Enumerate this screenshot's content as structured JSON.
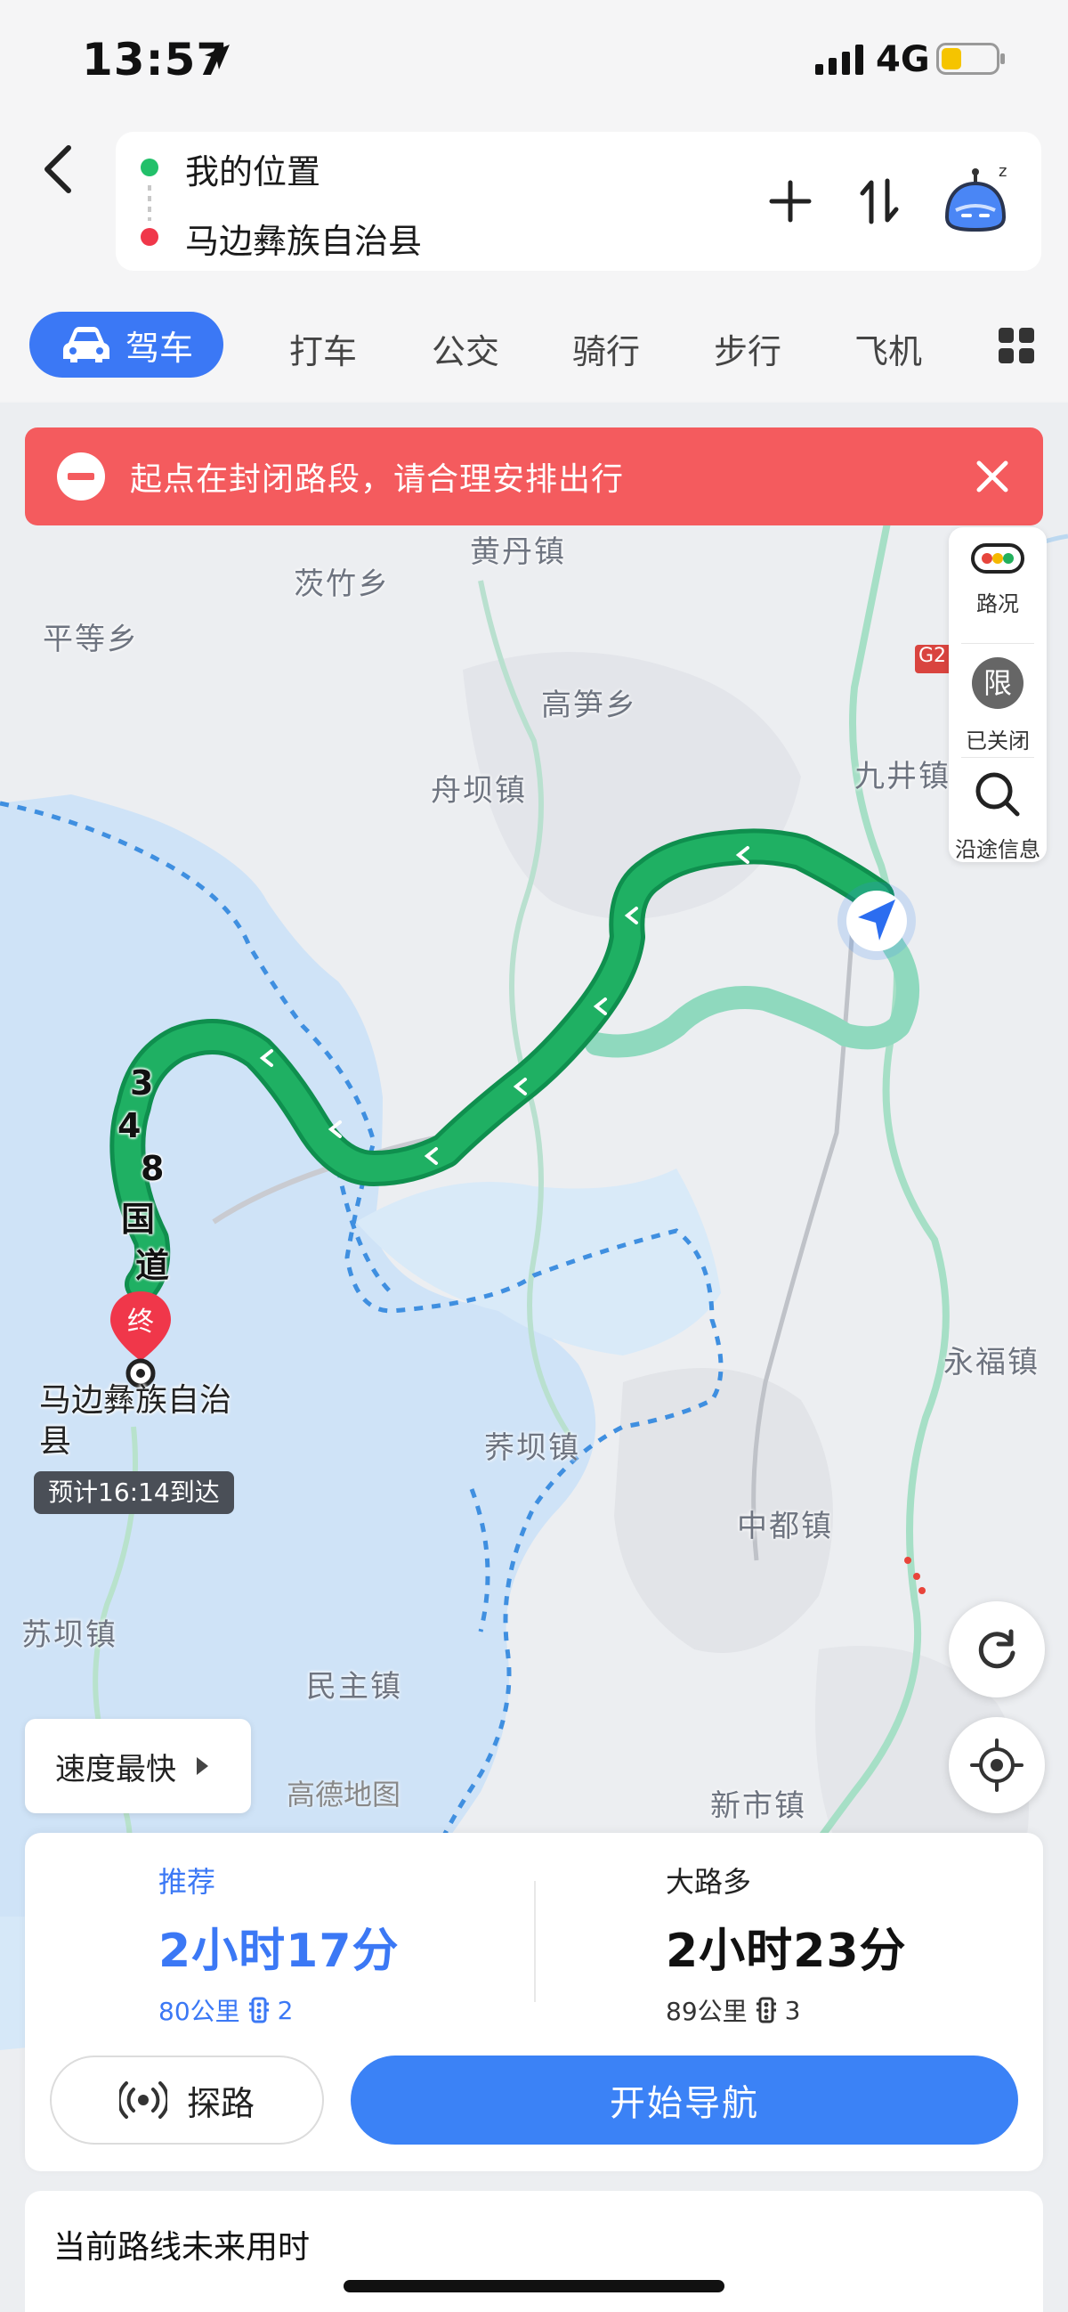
{
  "status": {
    "time": "13:57",
    "network": "4G",
    "battery_color": "#f5c400"
  },
  "route": {
    "start": "我的位置",
    "end": "马边彝族自治县"
  },
  "tabs": {
    "active": "驾车",
    "items": [
      "打车",
      "公交",
      "骑行",
      "步行",
      "飞机"
    ]
  },
  "alert": {
    "text": "起点在封闭路段，请合理安排出行"
  },
  "side_panel": {
    "traffic": "路况",
    "restriction_glyph": "限",
    "restriction": "已关闭",
    "along_route": "沿途信息"
  },
  "map": {
    "labels": {
      "huangdan": "黄丹镇",
      "cizhu": "茨竹乡",
      "pingdeng": "平等乡",
      "gaosun": "高笋乡",
      "zhouba": "舟坝镇",
      "jiujing": "九井镇",
      "yongfu": "永福镇",
      "jiba": "荞坝镇",
      "zhongdu": "中都镇",
      "suba": "苏坝镇",
      "minzhu": "民主镇",
      "xinshi": "新市镇",
      "highway": "G2"
    },
    "road_name_chars": [
      "3",
      "4",
      "8",
      "国",
      "道"
    ],
    "end_marker_glyph": "终",
    "end_name": "马边彝族自治县",
    "eta": "预计16:14到达",
    "watermark": "高德地图",
    "speed_option": "速度最快",
    "colors": {
      "route_main": "#1fb063",
      "route_alt": "#8fd9be",
      "water": "#c9e1f7",
      "boundary": "#3d8fe0"
    }
  },
  "options": [
    {
      "tag": "推荐",
      "time": "2小时17分",
      "distance": "80公里",
      "lights": "2"
    },
    {
      "tag": "大路多",
      "time": "2小时23分",
      "distance": "89公里",
      "lights": "3"
    }
  ],
  "buttons": {
    "explore": "探路",
    "start_navigation": "开始导航"
  },
  "future": {
    "title": "当前路线未来用时"
  }
}
